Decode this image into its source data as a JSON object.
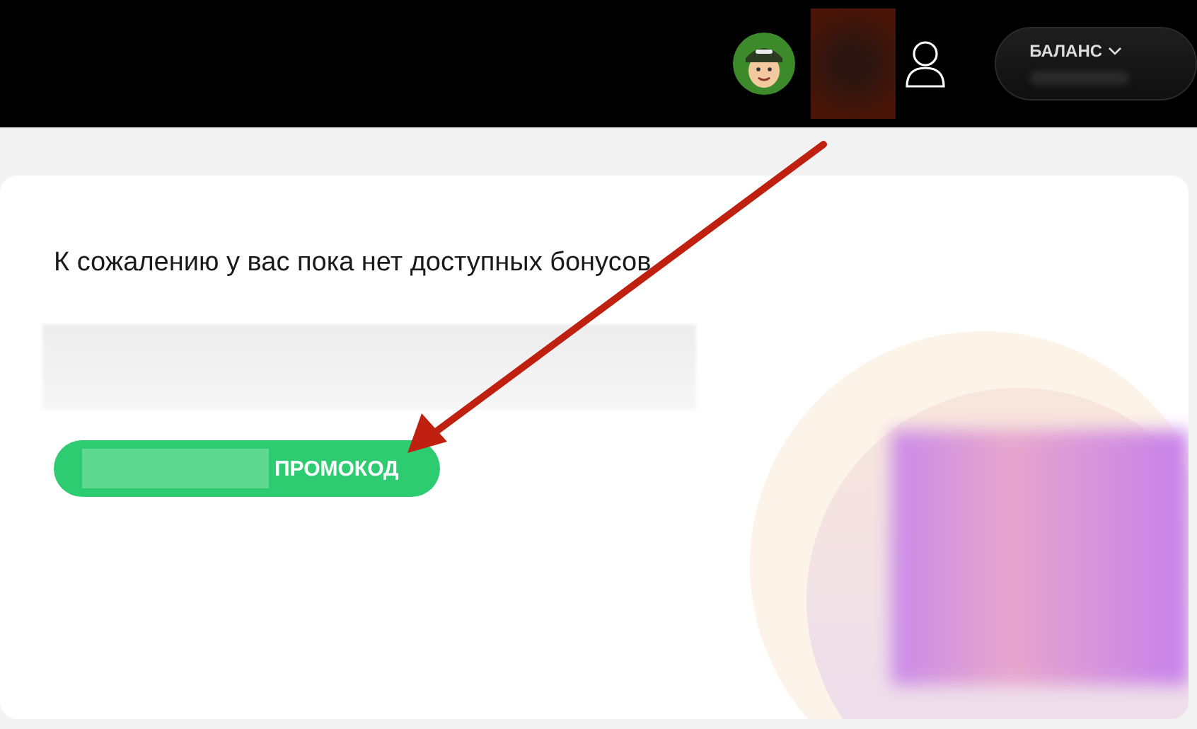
{
  "header": {
    "balance_label": "БАЛАНС"
  },
  "card": {
    "message": "К сожалению у вас пока нет доступных бонусов",
    "button_label": "ПРОМОКОД"
  }
}
